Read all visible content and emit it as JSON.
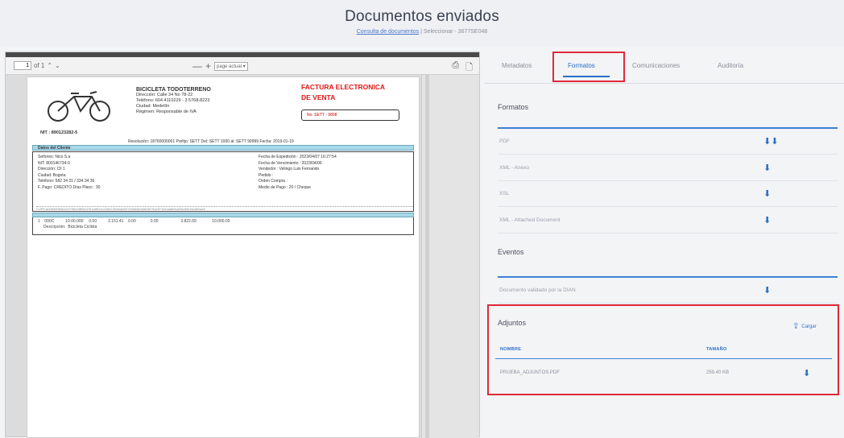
{
  "header": {
    "title": "Documentos enviados",
    "crumb_link": "Consulta de documentos",
    "crumb_rest": " | Seleccionar - 3677SE048"
  },
  "viewer": {
    "page_input": "1",
    "page_of": "of 1",
    "zoom_label": "page actual",
    "zoom_minus": "—",
    "zoom_plus": "+",
    "print_icon": "print-icon",
    "save_icon": "save-icon"
  },
  "invoice": {
    "company_name": "BICICLETA TODOTERRENO",
    "company_lines": [
      "Dirección: Calle 34 No 78-22",
      "Teléfono: 604 4110229 - 3 5768-8223",
      "Ciudad: Medellín",
      "Régimen: Responsable de IVA"
    ],
    "nit": "NIT : 890123282-5",
    "title_line1": "FACTURA ELECTRONICA",
    "title_line2": "DE VENTA",
    "number": "No. SETT - 9898",
    "resolution": "Resolución: 18760000001 Prefijo: SETT   Del: SETT 1000 al: SETT 99999 Fecha: 2019-01-19",
    "client_bar": "Datos del Cliente",
    "client_left": [
      "Señores: Nico S.a",
      "NIT: 800146734-0",
      "Dirección: Cll 1",
      "Ciudad: Bogota",
      "Teléfono: 582 34 31 / 334 34 36",
      "F. Pago: CREDITO      Días Plazo : 30"
    ],
    "client_right": [
      "Fecha de Expedición : 2023/04/07   16:27:54",
      "Fecha de Vencimiento : 2023/04/06",
      "Vendedor : Velingo Luis Fernando",
      "Pedido :",
      "Orden Compra :",
      "Medio de Pago : 20 / Cheque"
    ],
    "cufe": "CUFE:a0084f45b5c2c079bee869447b1dd014c21ba72ecfcab0374d4e8e4cbb3e79ce571eecaa5dca23cdbe14a4b2aee",
    "item_line1": "1    000C          10.00.000     0.00          3.151.41    0.00             0.00                    3.822.69              10.000.00",
    "item_line2": "     Descripción:  Bicicleta Ciclista"
  },
  "tabs": [
    {
      "label": "Metadatos",
      "active": false
    },
    {
      "label": "Formatos",
      "active": true
    },
    {
      "label": "Comunicaciones",
      "active": false
    },
    {
      "label": "Auditoría",
      "active": false
    }
  ],
  "formatos": {
    "title": "Formatos",
    "rows": [
      "PDF",
      "XML - Anexo",
      "XSL",
      "XML - Attached Document"
    ]
  },
  "eventos": {
    "title": "Eventos",
    "rows": [
      "Documento validado por la DIAN"
    ]
  },
  "adjuntos": {
    "title": "Adjuntos",
    "upload_label": "Cargar",
    "col_name": "NOMBRE",
    "col_size": "TAMAÑO",
    "files": [
      {
        "name": "PRUEBA_ADJUNTOS.PDF",
        "size": "259.40 KB"
      }
    ]
  },
  "colors": {
    "accent": "#2a6fc6",
    "highlight": "#e0283a",
    "invoice_title": "#e01616",
    "table_header": "#a8d8e8"
  }
}
